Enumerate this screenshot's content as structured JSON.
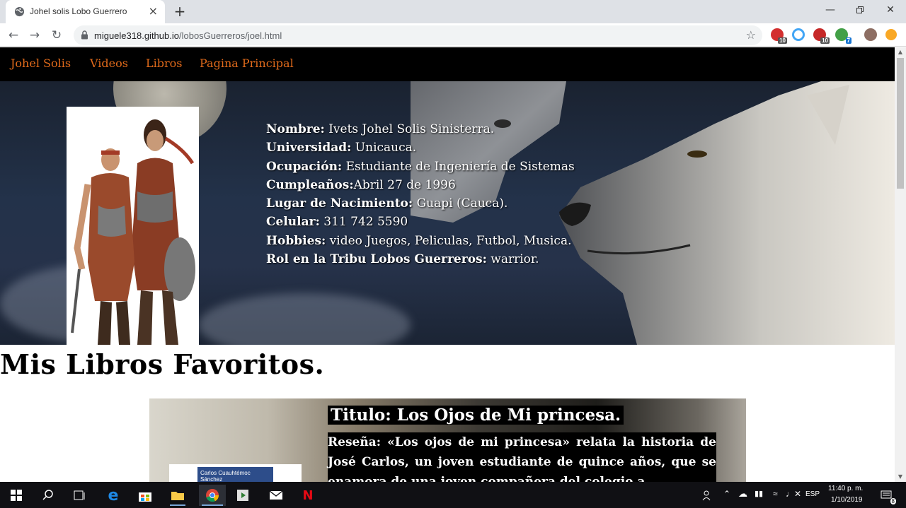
{
  "browser": {
    "tab_title": "Johel solis Lobo Guerrero",
    "tab_close": "×",
    "new_tab": "+",
    "url_host": "miguele318.github.io",
    "url_path": "/lobosGuerreros/joel.html",
    "extensions": [
      {
        "name": "adblock-icon",
        "badge": "10",
        "color": "#d32f2f"
      },
      {
        "name": "sync-icon",
        "badge": "",
        "color": "#42a5f5"
      },
      {
        "name": "abp-icon",
        "badge": "10",
        "color": "#c62828"
      },
      {
        "name": "download-icon",
        "badge": "7",
        "color": "#43a047"
      }
    ]
  },
  "site_nav": {
    "items": [
      "Johel Solis",
      "Videos",
      "Libros",
      "Pagina Principal"
    ]
  },
  "profile": {
    "fields": [
      {
        "label": "Nombre:",
        "value": " Ivets Johel Solis Sinisterra."
      },
      {
        "label": "Universidad:",
        "value": " Unicauca."
      },
      {
        "label": "Ocupación:",
        "value": " Estudiante de Ingeniería de Sistemas"
      },
      {
        "label": "Cumpleaños:",
        "value": "Abril 27 de 1996"
      },
      {
        "label": "Lugar de Nacimiento:",
        "value": " Guapi (Cauca)."
      },
      {
        "label": "Celular:",
        "value": " 311 742 5590"
      },
      {
        "label": "Hobbies:",
        "value": " video Juegos, Peliculas, Futbol, Musica."
      },
      {
        "label": "Rol en la Tribu Lobos Guerreros:",
        "value": " warrior."
      }
    ]
  },
  "books": {
    "section_title": "Mis Libros Favoritos.",
    "cover_text": "Carlos Cuauhtémoc Sánchez",
    "title": "Titulo: Los Ojos de Mi princesa.",
    "review": "Reseña: «Los ojos de mi princesa» relata la historia de José Carlos, un joven estudiante de quince años, que se enamora de una joven compañera del colegio a"
  },
  "taskbar": {
    "language": "ESP",
    "time": "11:40 p. m.",
    "date": "1/10/2019",
    "notifications": "8"
  }
}
